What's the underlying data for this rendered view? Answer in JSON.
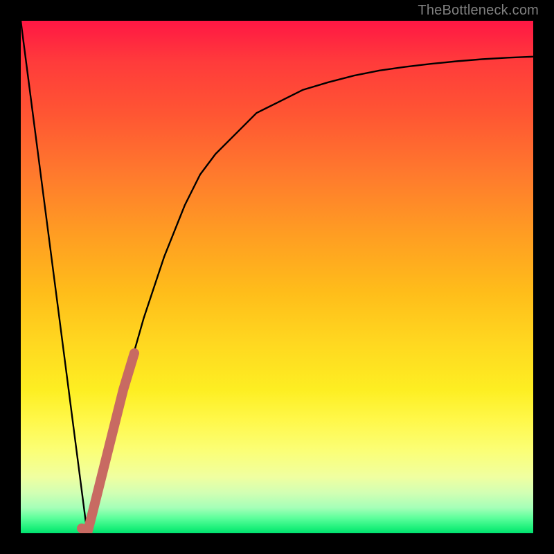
{
  "attribution": "TheBottleneck.com",
  "colors": {
    "frame": "#000000",
    "curve": "#000000",
    "highlight": "#c86a62",
    "gradient_top": "#ff1744",
    "gradient_bottom": "#00e070"
  },
  "chart_data": {
    "type": "line",
    "title": "",
    "xlabel": "",
    "ylabel": "",
    "xlim": [
      0,
      100
    ],
    "ylim": [
      0,
      100
    ],
    "grid": false,
    "series": [
      {
        "name": "bottleneck-curve",
        "x": [
          0,
          2,
          4,
          6,
          8,
          10,
          12,
          13,
          14,
          16,
          18,
          20,
          22,
          24,
          26,
          28,
          30,
          32,
          35,
          38,
          42,
          46,
          50,
          55,
          60,
          65,
          70,
          75,
          80,
          85,
          90,
          95,
          100
        ],
        "y": [
          100,
          85,
          70,
          55,
          40,
          25,
          10,
          0,
          4,
          12,
          20,
          28,
          35,
          42,
          48,
          54,
          59,
          64,
          70,
          74,
          78,
          82,
          84,
          86.5,
          88,
          89.3,
          90.3,
          91,
          91.6,
          92.1,
          92.5,
          92.8,
          93
        ]
      },
      {
        "name": "highlight-segment",
        "x": [
          12.5,
          13,
          14,
          16,
          18,
          20,
          22
        ],
        "y": [
          1,
          0,
          4,
          12,
          20,
          28,
          35
        ]
      }
    ],
    "annotations": []
  }
}
